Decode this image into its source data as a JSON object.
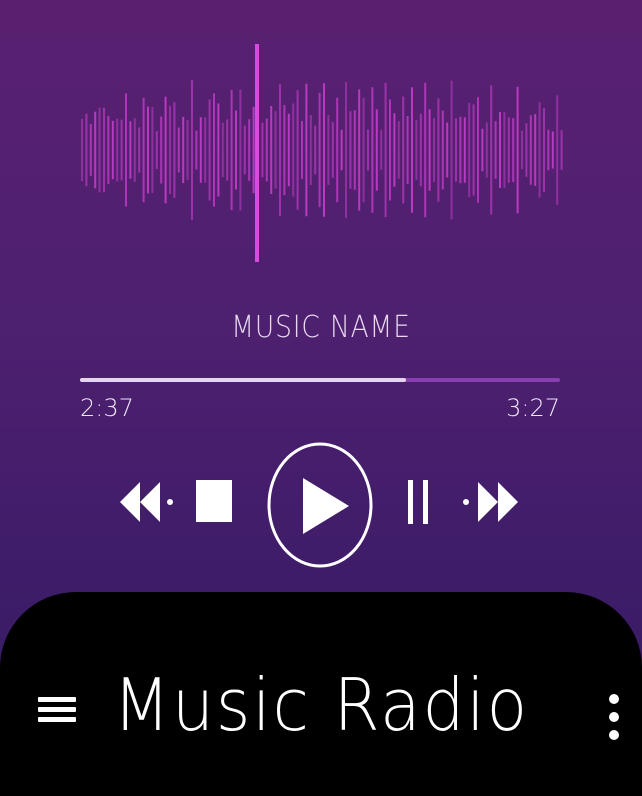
{
  "player": {
    "track_title": "MUSIC NAME",
    "elapsed": "2:37",
    "total": "3:27",
    "progress_fraction": 0.68
  },
  "controls": {
    "rewind_icon": "rewind-icon",
    "stop_icon": "stop-icon",
    "play_icon": "play-icon",
    "pause_icon": "pause-icon",
    "fast_forward_icon": "fast-forward-icon"
  },
  "app_bar": {
    "title": "Music Radio",
    "menu_icon": "hamburger-menu-icon",
    "more_icon": "more-vertical-icon"
  },
  "colors": {
    "background_top": "#5a2070",
    "background_bottom": "#341a60",
    "waveform": "#b93ac0",
    "waveform_center": "#d84ae0",
    "progress_played": "#e4d4ee",
    "progress_remaining": "#8a3fb0",
    "app_bar": "#000000"
  }
}
